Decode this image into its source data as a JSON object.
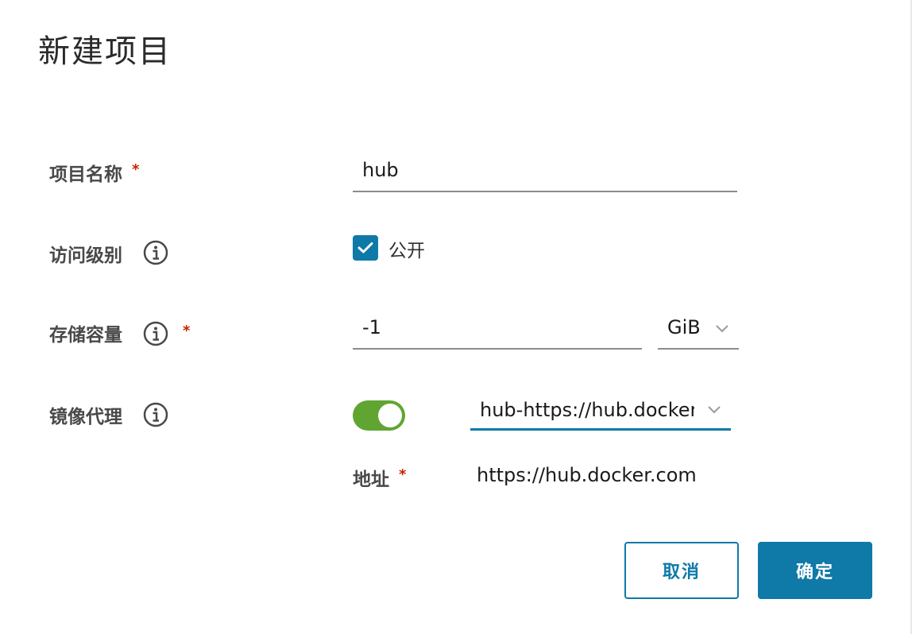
{
  "dialog": {
    "title": "新建项目"
  },
  "form": {
    "project_name": {
      "label": "项目名称",
      "required_mark": "*",
      "value": "hub"
    },
    "access_level": {
      "label": "访问级别",
      "checkbox_label": "公开",
      "checked": true
    },
    "storage": {
      "label": "存储容量",
      "required_mark": "*",
      "value": "-1",
      "unit": "GiB"
    },
    "proxy_cache": {
      "label": "镜像代理",
      "enabled": true,
      "selected_registry": "hub-https://hub.docker.com",
      "endpoint_label": "地址",
      "endpoint_required_mark": "*",
      "endpoint_value": "https://hub.docker.com"
    }
  },
  "buttons": {
    "cancel": "取消",
    "ok": "确定"
  },
  "colors": {
    "primary": "#0f79a8",
    "toggle_on": "#60a532",
    "required": "#c92100"
  },
  "icons": {
    "info": "info-circle-icon",
    "check": "check-icon",
    "chevron": "chevron-down-icon"
  }
}
